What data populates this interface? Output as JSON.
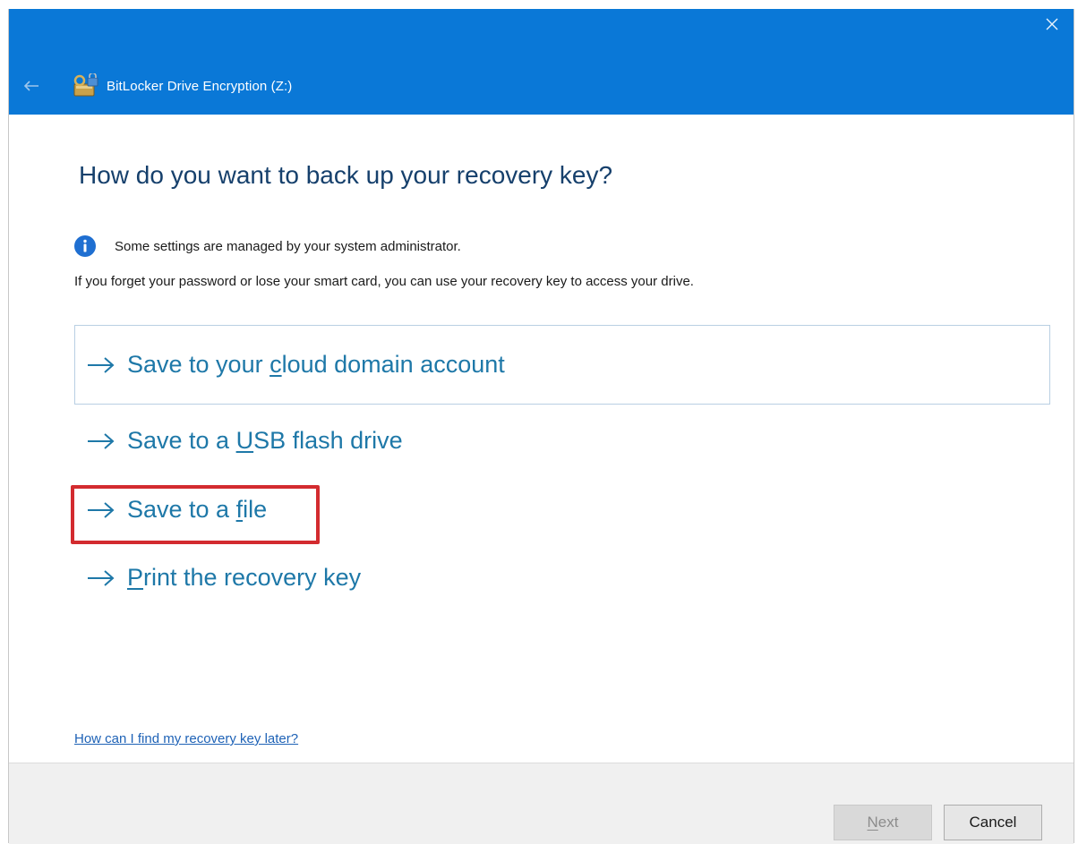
{
  "window": {
    "title": "BitLocker Drive Encryption (Z:)",
    "accent_color": "#0a78d7",
    "close_icon": "close-icon",
    "back_icon": "back-arrow-icon",
    "app_icon": "bitlocker-icon"
  },
  "main": {
    "heading": "How do you want to back up your recovery key?",
    "info_text": "Some settings are managed by your system administrator.",
    "description": "If you forget your password or lose your smart card, you can use your recovery key to access your drive.",
    "options": [
      {
        "pre": "Save to your ",
        "key": "c",
        "post": "loud domain account",
        "focused": true
      },
      {
        "pre": "Save to a ",
        "key": "U",
        "post": "SB flash drive"
      },
      {
        "pre": "Save to a ",
        "key": "f",
        "post": "ile",
        "highlighted": true
      },
      {
        "pre": "",
        "key": "P",
        "post": "rint the recovery key"
      }
    ],
    "help_link": "How can I find my recovery key later?"
  },
  "footer": {
    "next": {
      "key": "N",
      "rest": "ext",
      "enabled": false
    },
    "cancel_label": "Cancel"
  }
}
